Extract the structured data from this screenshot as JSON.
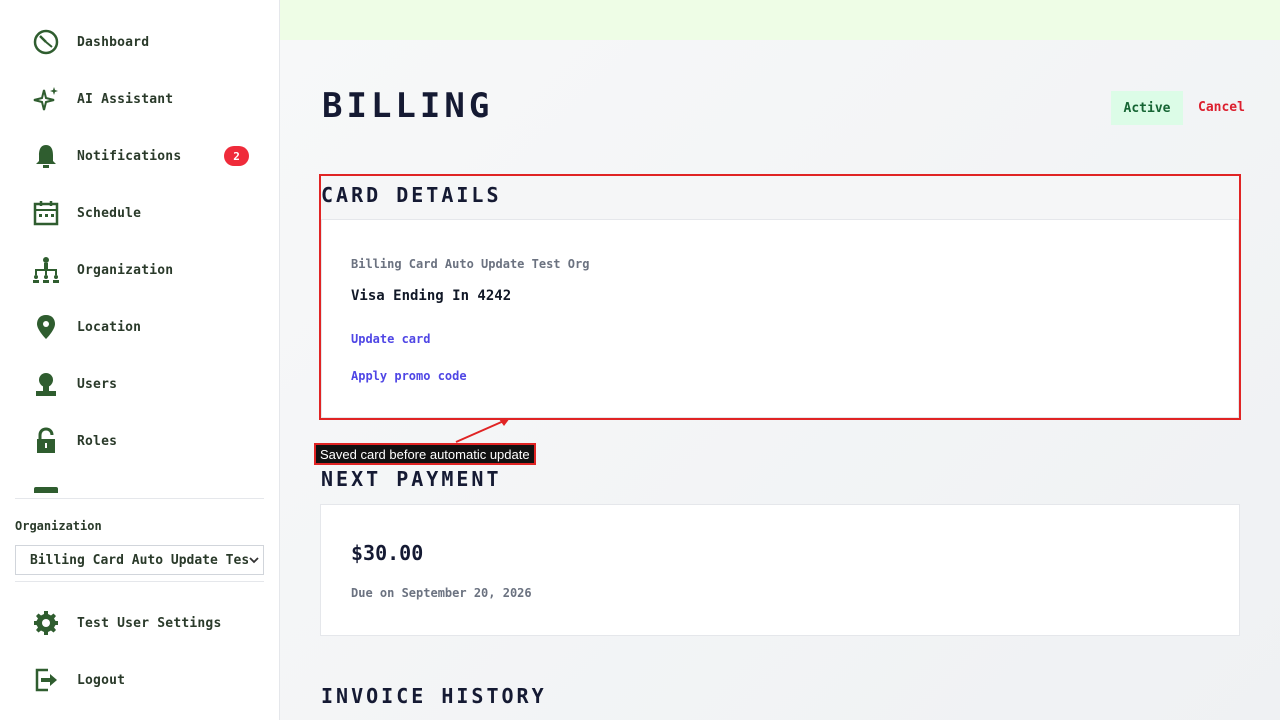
{
  "sidebar": {
    "items": [
      {
        "label": "Dashboard",
        "icon": "dashboard-icon"
      },
      {
        "label": "AI Assistant",
        "icon": "sparkle-icon"
      },
      {
        "label": "Notifications",
        "icon": "bell-icon",
        "badge": "2"
      },
      {
        "label": "Schedule",
        "icon": "calendar-icon"
      },
      {
        "label": "Organization",
        "icon": "org-chart-icon"
      },
      {
        "label": "Location",
        "icon": "location-pin-icon"
      },
      {
        "label": "Users",
        "icon": "user-icon"
      },
      {
        "label": "Roles",
        "icon": "lock-icon"
      }
    ],
    "organization_label": "Organization",
    "organization_value": "Billing Card Auto Update Test Org",
    "bottom_items": [
      {
        "label": "Test User Settings",
        "icon": "gear-icon"
      },
      {
        "label": "Logout",
        "icon": "logout-icon"
      }
    ]
  },
  "header": {
    "title": "BILLING",
    "status": "Active",
    "cancel_label": "Cancel"
  },
  "card_details": {
    "heading": "CARD DETAILS",
    "org_name": "Billing Card Auto Update Test Org",
    "description": "Visa Ending In 4242",
    "update_card_label": "Update card",
    "promo_label": "Apply promo code"
  },
  "annotation": {
    "text": "Saved card before automatic update"
  },
  "next_payment": {
    "heading": "NEXT PAYMENT",
    "amount": "$30.00",
    "due": "Due on September 20, 2026"
  },
  "invoice_history": {
    "heading": "INVOICE HISTORY"
  },
  "colors": {
    "sidebar_icon": "#2f5d2f",
    "accent_link": "#4f46e5",
    "danger": "#dc1f2e",
    "annotation_border": "#e02424",
    "active_bg": "#dcfce7",
    "active_text": "#166534"
  }
}
